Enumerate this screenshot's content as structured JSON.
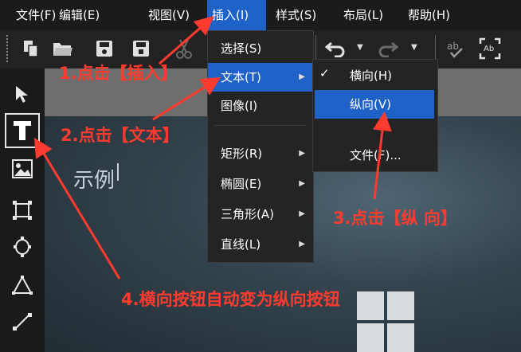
{
  "menubar": {
    "items": [
      "文件(F)",
      "编辑(E)",
      "视图(V)",
      "插入(I)",
      "样式(S)",
      "布局(L)",
      "帮助(H)"
    ],
    "active_index": 3
  },
  "toolbar": {
    "icons": [
      "copy-icon",
      "open-folder-icon",
      "save-icon",
      "save-as-icon",
      "cut-icon",
      "undo-icon",
      "redo-icon",
      "spell-check-icon",
      "text-frame-icon"
    ]
  },
  "tools": [
    "select-arrow-icon",
    "text-tool-icon",
    "image-tool-icon",
    "rectangle-tool-icon",
    "ellipse-tool-icon",
    "triangle-tool-icon",
    "line-tool-icon"
  ],
  "insert_menu": {
    "items": [
      {
        "label": "选择(S)",
        "has_submenu": false
      },
      {
        "label": "文本(T)",
        "has_submenu": true
      },
      {
        "label": "图像(I)",
        "has_submenu": false
      },
      {
        "label": "矩形(R)",
        "has_submenu": true
      },
      {
        "label": "椭圆(E)",
        "has_submenu": true
      },
      {
        "label": "三角形(A)",
        "has_submenu": true
      },
      {
        "label": "直线(L)",
        "has_submenu": true
      }
    ],
    "highlighted": "文本(T)"
  },
  "text_submenu": {
    "items": [
      {
        "label": "横向(H)",
        "checked": true
      },
      {
        "label": "纵向(V)",
        "checked": false
      },
      {
        "label": "文件(F)...",
        "checked": false
      }
    ],
    "highlighted": "纵向(V)"
  },
  "canvas": {
    "sample_text": "示例"
  },
  "annotations": {
    "step1": "1.点击【插入】",
    "step2": "2.点击【文本】",
    "step3": "3.点击【纵 向】",
    "step4": "4.横向按钮自动变为纵向按钮"
  },
  "colors": {
    "menu_highlight": "#1f62c7",
    "annotation": "#ff3b30",
    "menu_bg": "#242424"
  }
}
